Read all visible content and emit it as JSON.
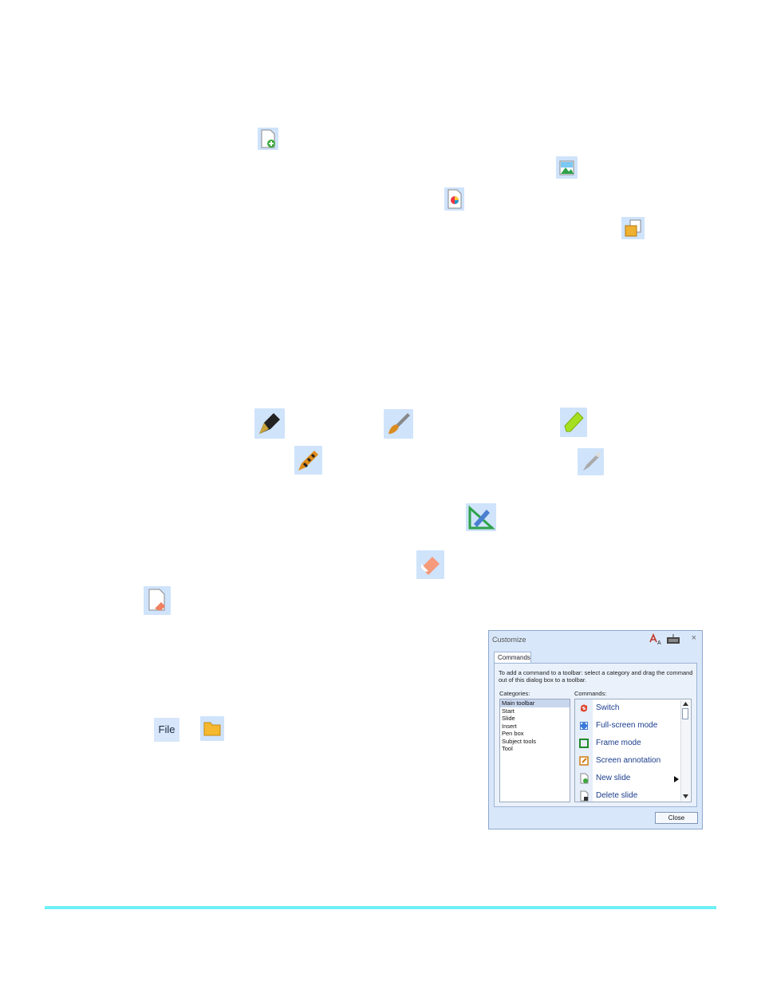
{
  "file_button": {
    "label": "File"
  },
  "dialog": {
    "title": "Customize",
    "close_glyph": "×",
    "tab_label": "Commands",
    "hint": "To add a command to a toolbar: select a category and drag the command out of this dialog box to a toolbar.",
    "categories_label": "Categories:",
    "commands_label": "Commands:",
    "categories": [
      "Main toolbar",
      "Start",
      "Slide",
      "Insert",
      "Pen box",
      "Subject tools",
      "Tool"
    ],
    "commands": [
      "Switch",
      "Full-screen mode",
      "Frame mode",
      "Screen annotation",
      "New slide",
      "Delete  slide"
    ],
    "close_button": "Close"
  },
  "accent_rule_color": "#6ff0f7"
}
